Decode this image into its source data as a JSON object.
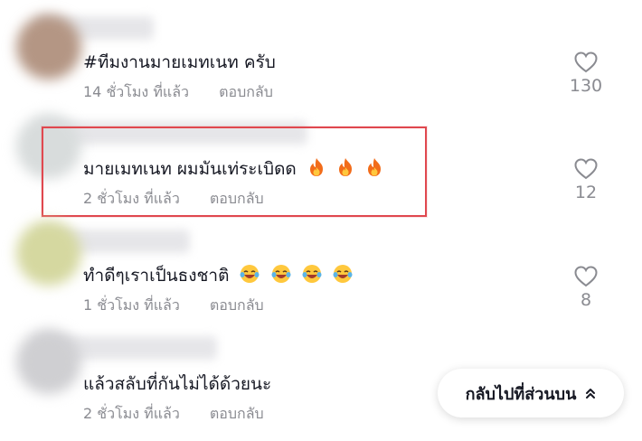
{
  "comments": [
    {
      "text": "#ทีมงานมายเมทเนท ครับ",
      "time": "14 ชั่วโมง ที่แล้ว",
      "reply": "ตอบกลับ",
      "likes": "130",
      "emoji_icon": null
    },
    {
      "text": "มายเมทเนท ผมมันเท่ระเบิดด",
      "time": "2 ชั่วโมง ที่แล้ว",
      "reply": "ตอบกลับ",
      "likes": "12",
      "emoji_icon": "fire-icon"
    },
    {
      "text": "ทำดีๆเราเป็นธงชาติ",
      "time": "1 ชั่วโมง ที่แล้ว",
      "reply": "ตอบกลับ",
      "likes": "8",
      "emoji_icon": "laughing-crying-icon"
    },
    {
      "text": "แล้วสลับที่กันไม่ได้ด้วยนะ",
      "time": "2 ชั่วโมง ที่แล้ว",
      "reply": "ตอบกลับ",
      "likes": null,
      "emoji_icon": null
    }
  ],
  "back_to_top": {
    "label": "กลับไปที่ส่วนบน",
    "icon": "double-chevron-up-icon"
  },
  "colors": {
    "highlight_border": "#e0484f",
    "meta_text": "#8a8b91",
    "primary_text": "#161823"
  }
}
